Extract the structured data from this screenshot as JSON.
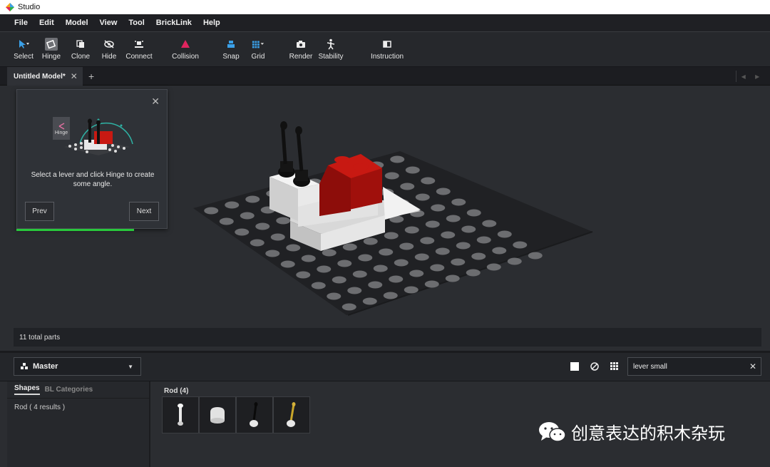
{
  "titlebar": {
    "app_title": "Studio",
    "icon": "studio-logo-icon"
  },
  "menu": [
    "File",
    "Edit",
    "Model",
    "View",
    "Tool",
    "BrickLink",
    "Help"
  ],
  "toolbar": [
    {
      "label": "Select",
      "icon": "cursor-arrow-icon"
    },
    {
      "label": "Hinge",
      "icon": "hinge-icon",
      "active": true
    },
    {
      "label": "Clone",
      "icon": "clone-icon"
    },
    {
      "label": "Hide",
      "icon": "eye-slash-icon"
    },
    {
      "label": "Connect",
      "icon": "connect-icon"
    },
    {
      "label": "Collision",
      "icon": "collision-triangle-icon"
    },
    {
      "label": "Snap",
      "icon": "snap-icon"
    },
    {
      "label": "Grid",
      "icon": "grid-icon"
    },
    {
      "label": "Render",
      "icon": "camera-icon"
    },
    {
      "label": "Stability",
      "icon": "stability-icon"
    },
    {
      "label": "Instruction",
      "icon": "book-icon"
    }
  ],
  "tabs": {
    "active": "Untitled Model*",
    "close": "✕",
    "add": "+"
  },
  "tutorial": {
    "badge": "Hinge",
    "text": "Select a lever and click Hinge to create some angle.",
    "prev": "Prev",
    "next": "Next",
    "close": "✕",
    "progress": 0.78
  },
  "status": {
    "text": "11 total parts"
  },
  "palette": {
    "set": "Master",
    "search_value": "lever small",
    "search_clear": "✕",
    "tabs": [
      "Shapes",
      "BL Categories"
    ],
    "result": "Rod ( 4 results )",
    "group_title": "Rod (4)",
    "parts": [
      "rod-white-icon",
      "cap-white-icon",
      "lever-black-icon",
      "lever-gold-icon"
    ]
  },
  "watermark": {
    "text": "创意表达的积木杂玩",
    "icon": "wechat-icon"
  },
  "colors": {
    "accent_green": "#28c83c",
    "collision_pink": "#e0245e",
    "snap_blue": "#3aa0e8",
    "brick_red": "#b5140f"
  }
}
